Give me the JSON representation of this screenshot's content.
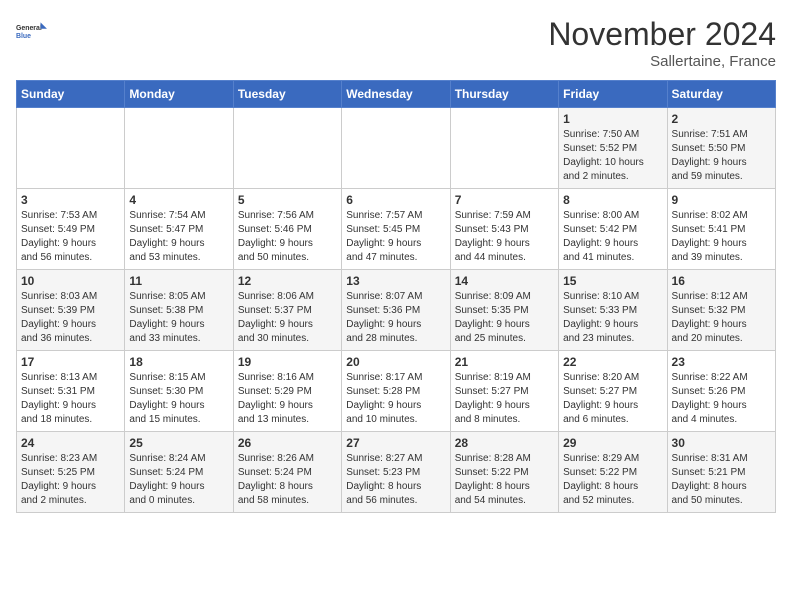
{
  "header": {
    "logo_line1": "General",
    "logo_line2": "Blue",
    "month": "November 2024",
    "location": "Sallertaine, France"
  },
  "weekdays": [
    "Sunday",
    "Monday",
    "Tuesday",
    "Wednesday",
    "Thursday",
    "Friday",
    "Saturday"
  ],
  "weeks": [
    [
      {
        "day": "",
        "info": ""
      },
      {
        "day": "",
        "info": ""
      },
      {
        "day": "",
        "info": ""
      },
      {
        "day": "",
        "info": ""
      },
      {
        "day": "",
        "info": ""
      },
      {
        "day": "1",
        "info": "Sunrise: 7:50 AM\nSunset: 5:52 PM\nDaylight: 10 hours\nand 2 minutes."
      },
      {
        "day": "2",
        "info": "Sunrise: 7:51 AM\nSunset: 5:50 PM\nDaylight: 9 hours\nand 59 minutes."
      }
    ],
    [
      {
        "day": "3",
        "info": "Sunrise: 7:53 AM\nSunset: 5:49 PM\nDaylight: 9 hours\nand 56 minutes."
      },
      {
        "day": "4",
        "info": "Sunrise: 7:54 AM\nSunset: 5:47 PM\nDaylight: 9 hours\nand 53 minutes."
      },
      {
        "day": "5",
        "info": "Sunrise: 7:56 AM\nSunset: 5:46 PM\nDaylight: 9 hours\nand 50 minutes."
      },
      {
        "day": "6",
        "info": "Sunrise: 7:57 AM\nSunset: 5:45 PM\nDaylight: 9 hours\nand 47 minutes."
      },
      {
        "day": "7",
        "info": "Sunrise: 7:59 AM\nSunset: 5:43 PM\nDaylight: 9 hours\nand 44 minutes."
      },
      {
        "day": "8",
        "info": "Sunrise: 8:00 AM\nSunset: 5:42 PM\nDaylight: 9 hours\nand 41 minutes."
      },
      {
        "day": "9",
        "info": "Sunrise: 8:02 AM\nSunset: 5:41 PM\nDaylight: 9 hours\nand 39 minutes."
      }
    ],
    [
      {
        "day": "10",
        "info": "Sunrise: 8:03 AM\nSunset: 5:39 PM\nDaylight: 9 hours\nand 36 minutes."
      },
      {
        "day": "11",
        "info": "Sunrise: 8:05 AM\nSunset: 5:38 PM\nDaylight: 9 hours\nand 33 minutes."
      },
      {
        "day": "12",
        "info": "Sunrise: 8:06 AM\nSunset: 5:37 PM\nDaylight: 9 hours\nand 30 minutes."
      },
      {
        "day": "13",
        "info": "Sunrise: 8:07 AM\nSunset: 5:36 PM\nDaylight: 9 hours\nand 28 minutes."
      },
      {
        "day": "14",
        "info": "Sunrise: 8:09 AM\nSunset: 5:35 PM\nDaylight: 9 hours\nand 25 minutes."
      },
      {
        "day": "15",
        "info": "Sunrise: 8:10 AM\nSunset: 5:33 PM\nDaylight: 9 hours\nand 23 minutes."
      },
      {
        "day": "16",
        "info": "Sunrise: 8:12 AM\nSunset: 5:32 PM\nDaylight: 9 hours\nand 20 minutes."
      }
    ],
    [
      {
        "day": "17",
        "info": "Sunrise: 8:13 AM\nSunset: 5:31 PM\nDaylight: 9 hours\nand 18 minutes."
      },
      {
        "day": "18",
        "info": "Sunrise: 8:15 AM\nSunset: 5:30 PM\nDaylight: 9 hours\nand 15 minutes."
      },
      {
        "day": "19",
        "info": "Sunrise: 8:16 AM\nSunset: 5:29 PM\nDaylight: 9 hours\nand 13 minutes."
      },
      {
        "day": "20",
        "info": "Sunrise: 8:17 AM\nSunset: 5:28 PM\nDaylight: 9 hours\nand 10 minutes."
      },
      {
        "day": "21",
        "info": "Sunrise: 8:19 AM\nSunset: 5:27 PM\nDaylight: 9 hours\nand 8 minutes."
      },
      {
        "day": "22",
        "info": "Sunrise: 8:20 AM\nSunset: 5:27 PM\nDaylight: 9 hours\nand 6 minutes."
      },
      {
        "day": "23",
        "info": "Sunrise: 8:22 AM\nSunset: 5:26 PM\nDaylight: 9 hours\nand 4 minutes."
      }
    ],
    [
      {
        "day": "24",
        "info": "Sunrise: 8:23 AM\nSunset: 5:25 PM\nDaylight: 9 hours\nand 2 minutes."
      },
      {
        "day": "25",
        "info": "Sunrise: 8:24 AM\nSunset: 5:24 PM\nDaylight: 9 hours\nand 0 minutes."
      },
      {
        "day": "26",
        "info": "Sunrise: 8:26 AM\nSunset: 5:24 PM\nDaylight: 8 hours\nand 58 minutes."
      },
      {
        "day": "27",
        "info": "Sunrise: 8:27 AM\nSunset: 5:23 PM\nDaylight: 8 hours\nand 56 minutes."
      },
      {
        "day": "28",
        "info": "Sunrise: 8:28 AM\nSunset: 5:22 PM\nDaylight: 8 hours\nand 54 minutes."
      },
      {
        "day": "29",
        "info": "Sunrise: 8:29 AM\nSunset: 5:22 PM\nDaylight: 8 hours\nand 52 minutes."
      },
      {
        "day": "30",
        "info": "Sunrise: 8:31 AM\nSunset: 5:21 PM\nDaylight: 8 hours\nand 50 minutes."
      }
    ]
  ]
}
